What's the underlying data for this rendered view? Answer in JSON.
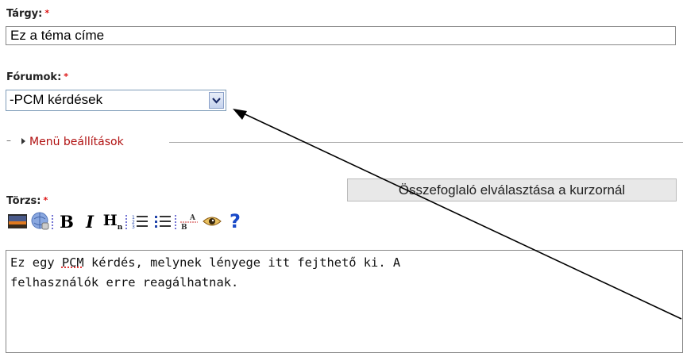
{
  "subject": {
    "label": "Tárgy:",
    "required_mark": "*",
    "value": "Ez a téma címe"
  },
  "forums": {
    "label": "Fórumok:",
    "required_mark": "*",
    "selected": "-PCM kérdések",
    "dropdown_icon": "chevron-down-icon"
  },
  "menu_settings": {
    "legend": "Menü beállítások",
    "collapsed_marker": "–"
  },
  "body": {
    "label": "Törzs:",
    "required_mark": "*",
    "split_button": "Összefoglaló elválasztása a kurzornál",
    "toolbar": [
      {
        "name": "image-icon",
        "title": "Image"
      },
      {
        "name": "link-icon",
        "title": "Link"
      },
      {
        "name": "bold-icon",
        "glyph": "B"
      },
      {
        "name": "italic-icon",
        "glyph": "I"
      },
      {
        "name": "heading-icon",
        "glyph": "H",
        "sub": "n"
      },
      {
        "name": "ordered-list-icon"
      },
      {
        "name": "unordered-list-icon"
      },
      {
        "name": "footnote-icon",
        "glyph_top": "A",
        "glyph_bottom": "B"
      },
      {
        "name": "preview-icon"
      },
      {
        "name": "help-icon",
        "glyph": "?"
      }
    ],
    "text_line1_pre": "Ez egy ",
    "text_pcm": "PCM",
    "text_line1_post": " kérdés, melynek lényege itt fejthető ki. A",
    "text_line2": "felhasználók erre reagálhatnak."
  },
  "colors": {
    "required": "#dd1111",
    "legend": "#b01010",
    "annotation_arrow": "#000000"
  }
}
